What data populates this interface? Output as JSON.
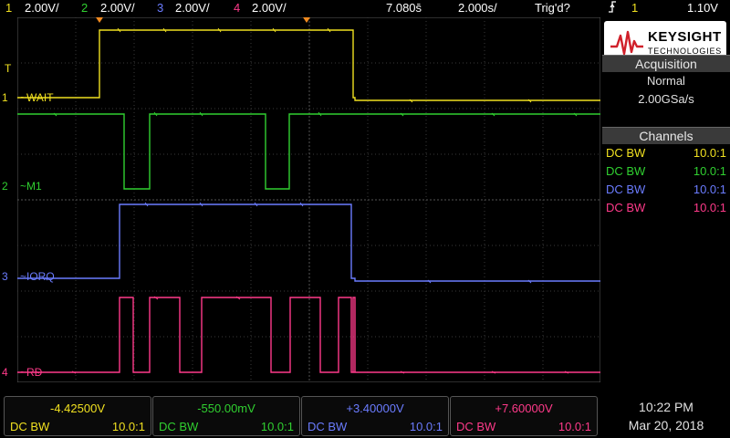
{
  "topbar": {
    "ch1_num": "1",
    "ch1_scale": "2.00V/",
    "ch2_num": "2",
    "ch2_scale": "2.00V/",
    "ch3_num": "3",
    "ch3_scale": "2.00V/",
    "ch4_num": "4",
    "ch4_scale": "2.00V/",
    "time_offset": "7.080s̄",
    "timebase": "2.000s/",
    "trig_status": "Trig'd?",
    "trig_slope_icon": "rising-edge-icon",
    "trig_channel": "1",
    "trig_level": "1.10V"
  },
  "traces": {
    "ch1_label": "~WAIT",
    "ch2_label": "~M1",
    "ch3_label": "~IORQ",
    "ch4_label": "~RD",
    "ch1_marker": "1",
    "ch2_marker": "2",
    "ch3_marker": "3",
    "ch4_marker": "4",
    "trigger_marker": "T"
  },
  "panel": {
    "brand": "KEYSIGHT",
    "brand_sub": "TECHNOLOGIES",
    "acq_title": "Acquisition",
    "acq_mode": "Normal",
    "acq_rate": "2.00GSa/s",
    "channels_title": "Channels",
    "channels": [
      {
        "coupling": "DC BW",
        "probe": "10.0:1"
      },
      {
        "coupling": "DC BW",
        "probe": "10.0:1"
      },
      {
        "coupling": "DC BW",
        "probe": "10.0:1"
      },
      {
        "coupling": "DC BW",
        "probe": "10.0:1"
      }
    ]
  },
  "bottom": {
    "ch1": {
      "offset": "-4.42500V",
      "coupling": "DC  BW",
      "probe": "10.0:1"
    },
    "ch2": {
      "offset": "-550.00mV",
      "coupling": "DC  BW",
      "probe": "10.0:1"
    },
    "ch3": {
      "offset": "+3.40000V",
      "coupling": "DC  BW",
      "probe": "10.0:1"
    },
    "ch4": {
      "offset": "+7.60000V",
      "coupling": "DC  BW",
      "probe": "10.0:1"
    }
  },
  "datetime": {
    "time": "10:22 PM",
    "date": "Mar 20, 2018"
  },
  "colors": {
    "ch1": "#f0e020",
    "ch2": "#30d030",
    "ch3": "#6b7cff",
    "ch4": "#ff3a8a",
    "grid": "#3a3a3a"
  }
}
